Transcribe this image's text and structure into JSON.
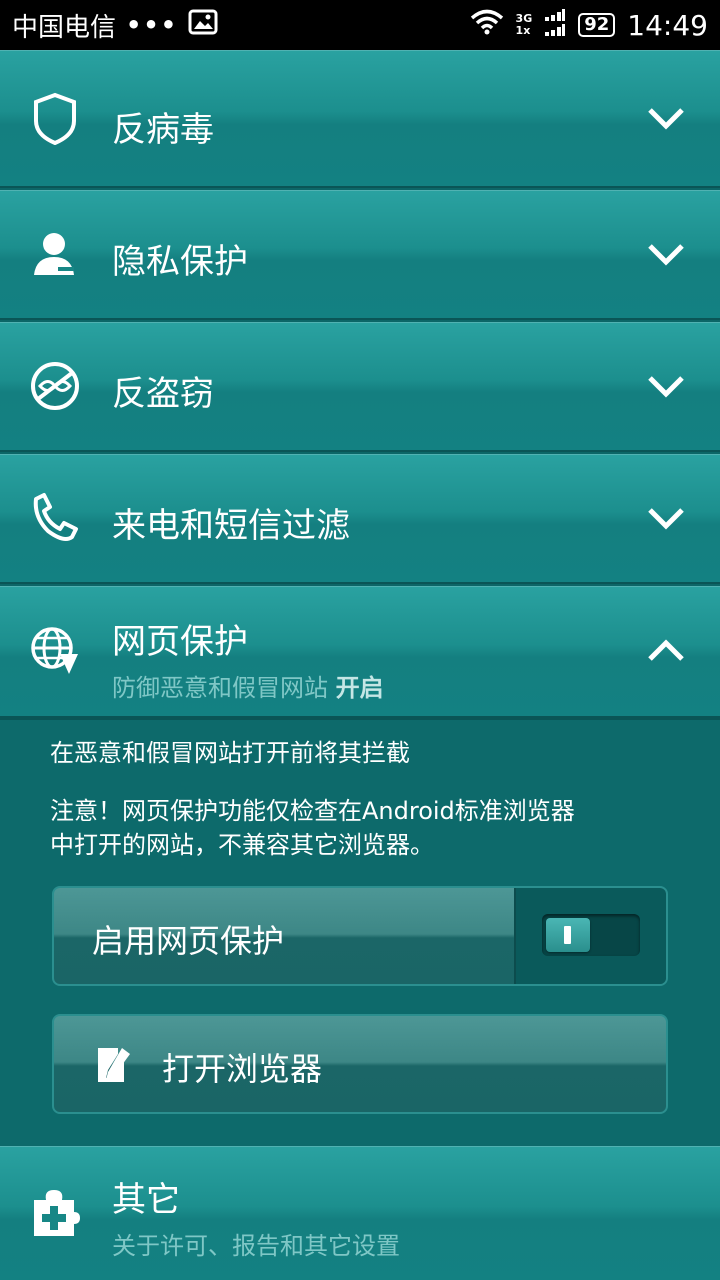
{
  "status_bar": {
    "carrier": "中国电信",
    "dots": "•••",
    "network_top": "3G",
    "network_bottom": "1x",
    "battery": "92",
    "time": "14:49"
  },
  "sections": {
    "antivirus": {
      "title": "反病毒"
    },
    "privacy": {
      "title": "隐私保护"
    },
    "antitheft": {
      "title": "反盗窃"
    },
    "call_filter": {
      "title": "来电和短信过滤"
    },
    "web_protection": {
      "title": "网页保护",
      "subtitle": "防御恶意和假冒网站",
      "state": "开启"
    },
    "other": {
      "title": "其它",
      "subtitle": "关于许可、报告和其它设置"
    }
  },
  "web_protection_panel": {
    "description": "在恶意和假冒网站打开前将其拦截",
    "note_line1": "注意！网页保护功能仅检查在Android标准浏览器",
    "note_line2": "中打开的网站，不兼容其它浏览器。",
    "toggle_label": "启用网页保护",
    "toggle_enabled": true,
    "open_browser_label": "打开浏览器"
  }
}
